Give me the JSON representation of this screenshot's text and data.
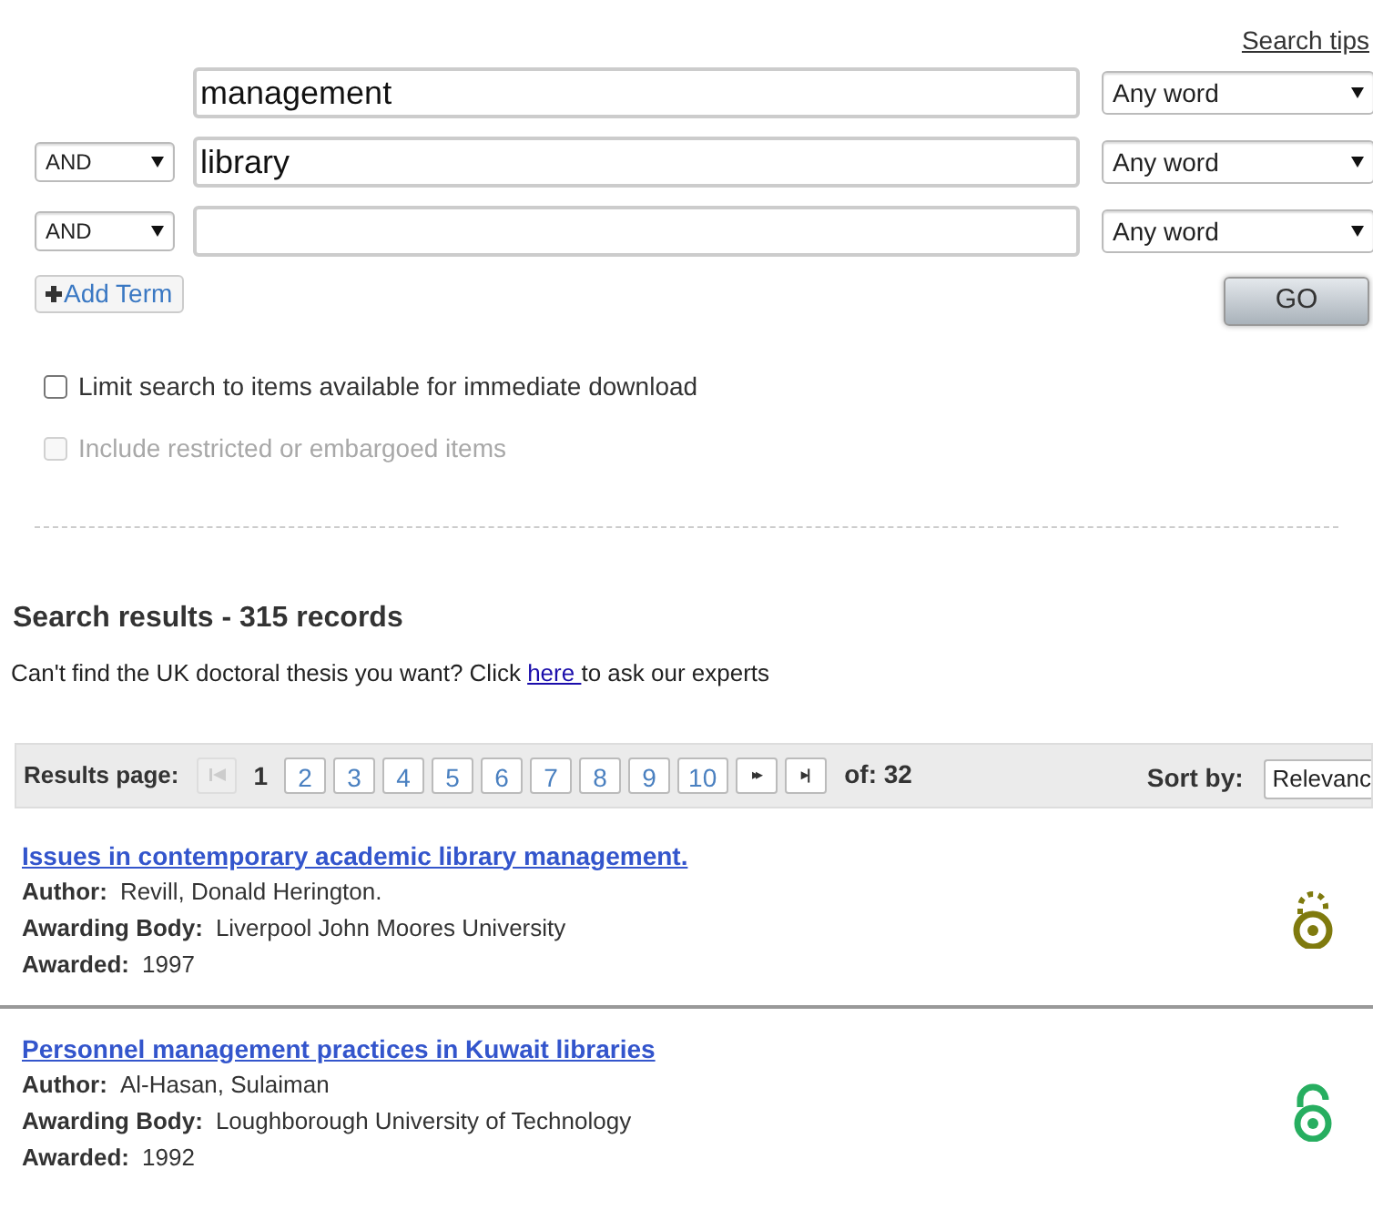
{
  "search_tips": "Search tips",
  "terms": [
    {
      "value": "management",
      "match": "Any word"
    },
    {
      "operator": "AND",
      "value": "library",
      "match": "Any word"
    },
    {
      "operator": "AND",
      "match": "Any word"
    }
  ],
  "add_term": "Add Term",
  "go": "GO",
  "options": [
    {
      "label": "Limit search to items available for immediate download",
      "checked": false,
      "disabled": false
    },
    {
      "label": "Include restricted or embargoed items",
      "checked": false,
      "disabled": true
    }
  ],
  "results_heading": "Search results - 315 records",
  "help": {
    "text": "Can't find the UK doctoral thesis you want? Click ",
    "link": "here ",
    "after": "to ask our experts"
  },
  "pager": {
    "label": "Results page:",
    "first_disabled": true,
    "pages": [
      {
        "label": "1",
        "selected": true
      },
      {
        "label": "2",
        "selected": false
      },
      {
        "label": "3",
        "selected": false
      },
      {
        "label": "4",
        "selected": false
      },
      {
        "label": "5",
        "selected": false
      },
      {
        "label": "6",
        "selected": false
      },
      {
        "label": "7",
        "selected": false
      },
      {
        "label": "8",
        "selected": false
      },
      {
        "label": "9",
        "selected": false
      },
      {
        "label": "10",
        "selected": false
      }
    ],
    "next": "▸▸",
    "last": "▸|",
    "total": "of: 32",
    "sort_label": "Sort by:",
    "sort_value": "Relevanc"
  },
  "results": [
    {
      "title": "Issues in contemporary academic library management.",
      "author_label": "Author:",
      "author": "Revill, Donald Herington.",
      "body_label": "Awarding Body:",
      "body": "Liverpool John Moores University",
      "awarded_label": "Awarded:",
      "awarded": "1997",
      "access": {
        "kind": "dashed",
        "color": "#7f7a0e"
      }
    },
    {
      "title": "Personnel management practices in Kuwait libraries",
      "author_label": "Author:",
      "author": "Al-Hasan, Sulaiman",
      "body_label": "Awarding Body:",
      "body": "Loughborough University of Technology",
      "awarded_label": "Awarded:",
      "awarded": "1992",
      "access": {
        "kind": "open",
        "color": "#27ae60"
      }
    }
  ]
}
